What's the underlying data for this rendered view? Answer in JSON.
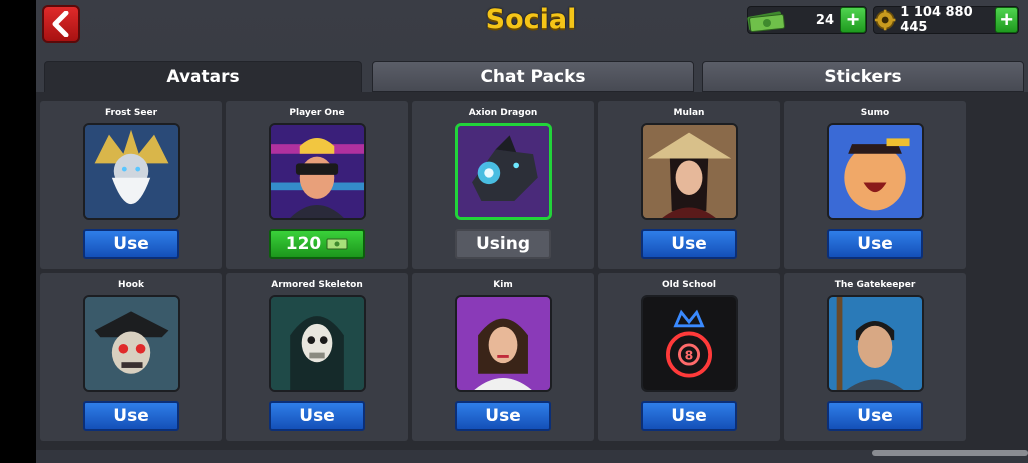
{
  "header": {
    "title": "Social",
    "back_icon": "chevron-left-icon"
  },
  "currency": {
    "cash": {
      "icon": "cash-icon",
      "value": "24"
    },
    "coins": {
      "icon": "coin-icon",
      "value": "1 104 880 445"
    }
  },
  "tabs": [
    {
      "label": "Avatars",
      "active": true
    },
    {
      "label": "Chat Packs",
      "active": false
    },
    {
      "label": "Stickers",
      "active": false
    }
  ],
  "avatars": [
    {
      "name": "Frost Seer",
      "action": "Use",
      "state": "use"
    },
    {
      "name": "Player One",
      "action": "120",
      "state": "price"
    },
    {
      "name": "Axion Dragon",
      "action": "Using",
      "state": "using"
    },
    {
      "name": "Mulan",
      "action": "Use",
      "state": "use"
    },
    {
      "name": "Sumo",
      "action": "Use",
      "state": "use"
    },
    {
      "name": "Hook",
      "action": "Use",
      "state": "use"
    },
    {
      "name": "Armored Skeleton",
      "action": "Use",
      "state": "use"
    },
    {
      "name": "Kim",
      "action": "Use",
      "state": "use"
    },
    {
      "name": "Old School",
      "action": "Use",
      "state": "use"
    },
    {
      "name": "The Gatekeeper",
      "action": "Use",
      "state": "use"
    }
  ],
  "colors": {
    "accent_gold": "#f5c518",
    "use_blue": "#1f66d6",
    "buy_green": "#2bb52b",
    "selected_green": "#22d43a"
  }
}
